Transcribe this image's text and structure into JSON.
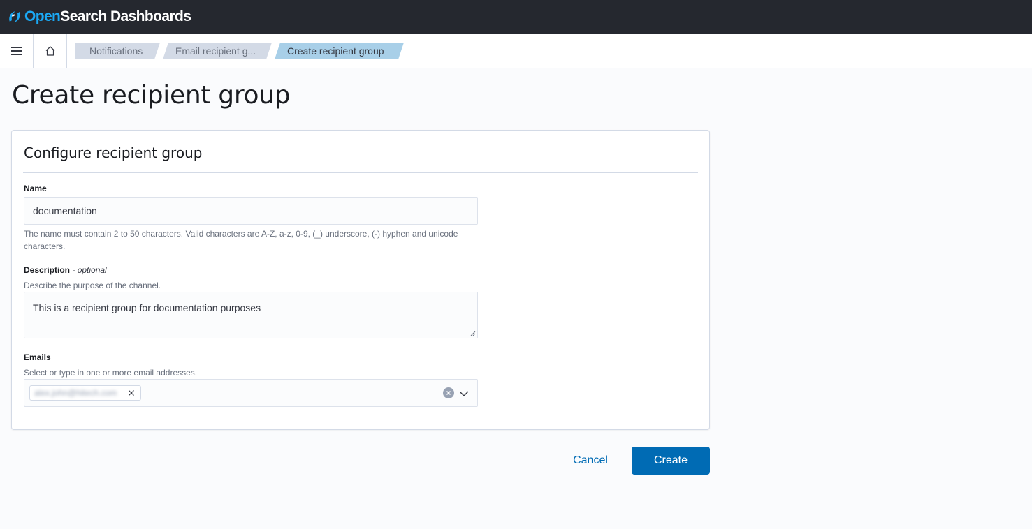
{
  "app": {
    "logo_open": "Open",
    "logo_rest": "Search Dashboards",
    "logo_icon": "opensearch-logo-icon"
  },
  "header": {
    "menu_icon": "hamburger-menu-icon",
    "home_icon": "home-icon",
    "breadcrumbs": [
      {
        "label": "Notifications"
      },
      {
        "label": "Email recipient g..."
      },
      {
        "label": "Create recipient group"
      }
    ]
  },
  "page": {
    "title": "Create recipient group"
  },
  "panel": {
    "title": "Configure recipient group",
    "name": {
      "label": "Name",
      "value": "documentation",
      "help": "The name must contain 2 to 50 characters. Valid characters are A-Z, a-z, 0-9, (_) underscore, (-) hyphen and unicode characters."
    },
    "description": {
      "label": "Description",
      "optional": "- optional",
      "help": "Describe the purpose of the channel.",
      "value": "This is a recipient group for documentation purposes"
    },
    "emails": {
      "label": "Emails",
      "help": "Select or type in one or more email addresses.",
      "chips": [
        {
          "value": "alex.john@hitech.com"
        }
      ]
    }
  },
  "actions": {
    "cancel_label": "Cancel",
    "create_label": "Create"
  },
  "colors": {
    "header_bg": "#25282f",
    "accent": "#006bb4",
    "crumb_active": "#a8cfe8",
    "crumb_inactive": "#d3dae6",
    "logo_blue": "#1ba9f5"
  }
}
